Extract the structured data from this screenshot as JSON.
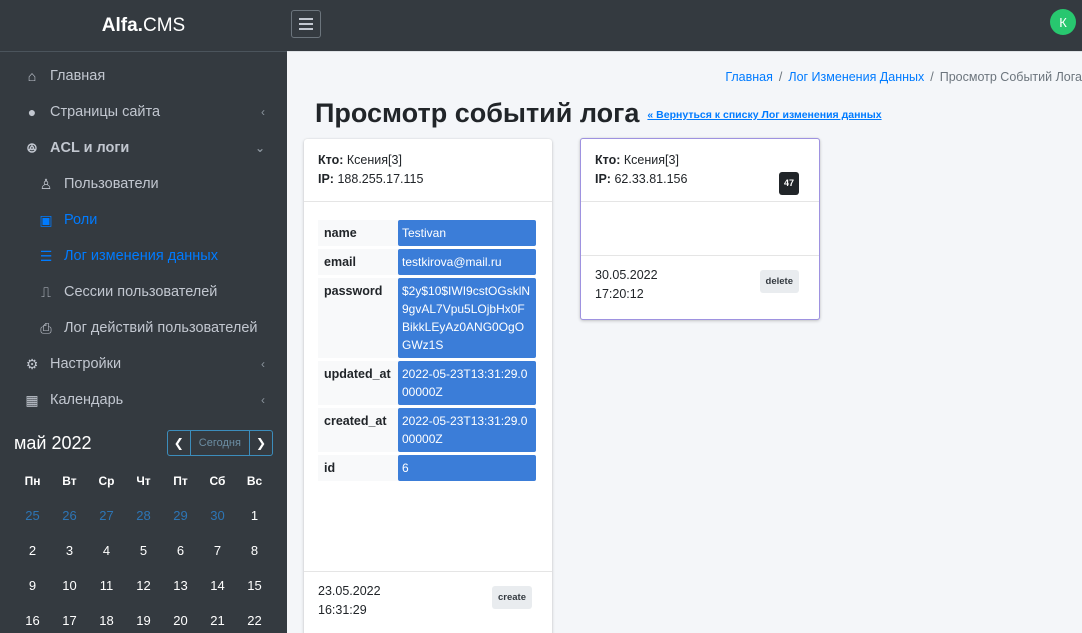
{
  "brand": {
    "bold": "Alfa.",
    "normal": "CMS"
  },
  "sidebar": {
    "items": [
      {
        "label": "Главная"
      },
      {
        "label": "Страницы сайта"
      },
      {
        "label": "ACL и логи"
      },
      {
        "label": "Пользователи"
      },
      {
        "label": "Роли"
      },
      {
        "label": "Лог изменения данных"
      },
      {
        "label": "Сессии пользователей"
      },
      {
        "label": "Лог действий пользователей"
      },
      {
        "label": "Настройки"
      },
      {
        "label": "Календарь"
      }
    ]
  },
  "calendar": {
    "title": "май 2022",
    "today_label": "Сегодня",
    "weekdays": [
      "Пн",
      "Вт",
      "Ср",
      "Чт",
      "Пт",
      "Сб",
      "Вс"
    ],
    "weeks": [
      [
        "25",
        "26",
        "27",
        "28",
        "29",
        "30",
        "1"
      ],
      [
        "2",
        "3",
        "4",
        "5",
        "6",
        "7",
        "8"
      ],
      [
        "9",
        "10",
        "11",
        "12",
        "13",
        "14",
        "15"
      ],
      [
        "16",
        "17",
        "18",
        "19",
        "20",
        "21",
        "22"
      ]
    ]
  },
  "user": {
    "initial": "К"
  },
  "breadcrumb": {
    "home": "Главная",
    "log": "Лог Изменения Данных",
    "current": "Просмотр Событий Лога"
  },
  "page": {
    "title": "Просмотр событий лога",
    "back_link": "« Вернуться к списку Лог изменения данных"
  },
  "events": [
    {
      "who_label": "Кто:",
      "who": "Ксения[3]",
      "ip_label": "IP:",
      "ip": "188.255.17.115",
      "fields": [
        {
          "key": "name",
          "value": "Testivan"
        },
        {
          "key": "email",
          "value": "testkirova@mail.ru"
        },
        {
          "key": "password",
          "value": "$2y$10$IWI9cstOGsklN9gvAL7Vpu5LOjbHx0FBikkLEyAz0ANG0OgOGWz1S"
        },
        {
          "key": "updated_at",
          "value": "2022-05-23T13:31:29.000000Z"
        },
        {
          "key": "created_at",
          "value": "2022-05-23T13:31:29.000000Z"
        },
        {
          "key": "id",
          "value": "6"
        }
      ],
      "date": "23.05.2022",
      "time": "16:31:29",
      "action": "create"
    },
    {
      "who_label": "Кто:",
      "who": "Ксения[3]",
      "ip_label": "IP:",
      "ip": "62.33.81.156",
      "count": "47",
      "date": "30.05.2022",
      "time": "17:20:12",
      "action": "delete"
    }
  ]
}
